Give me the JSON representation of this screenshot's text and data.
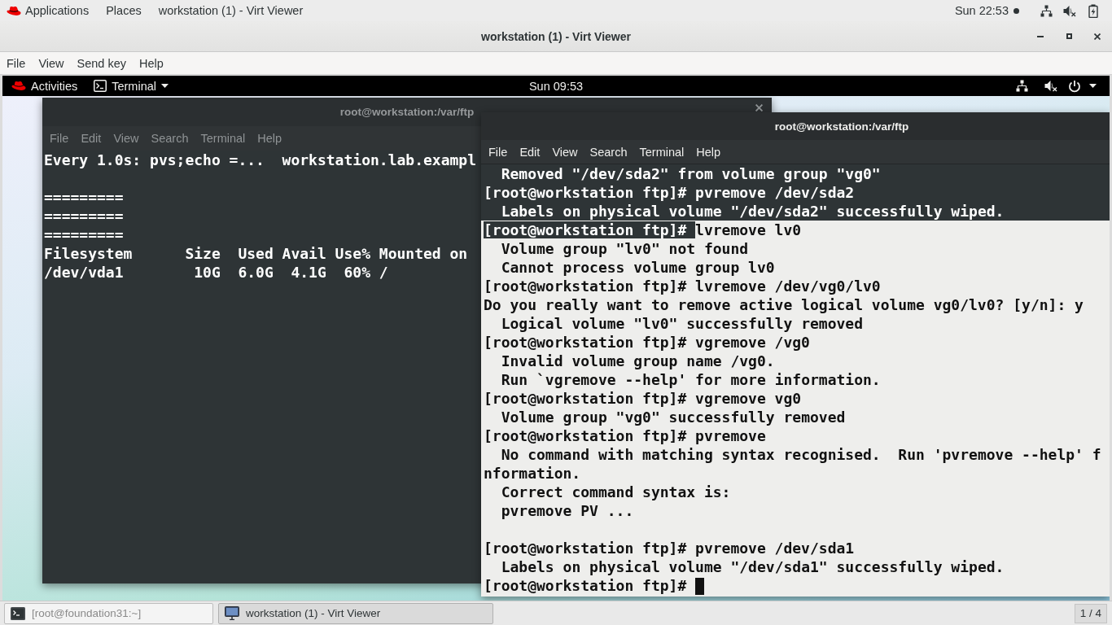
{
  "top_bar": {
    "menus": [
      "Applications",
      "Places"
    ],
    "window_title": "workstation (1) - Virt Viewer",
    "clock": "Sun 22:53"
  },
  "window": {
    "title": "workstation (1) - Virt Viewer",
    "menu": [
      "File",
      "View",
      "Send key",
      "Help"
    ]
  },
  "guest": {
    "top_bar": {
      "activities": "Activities",
      "app_menu": "Terminal",
      "clock": "Sun 09:53"
    },
    "terminals": [
      {
        "title": "root@workstation:/var/ftp",
        "focused": false,
        "dark_background": true,
        "cursor": false,
        "menu": [
          "File",
          "Edit",
          "View",
          "Search",
          "Terminal",
          "Help"
        ],
        "lines": [
          {
            "kind": "output",
            "text": "Every 1.0s: pvs;echo =...  workstation.lab.exampl"
          },
          {
            "kind": "blank"
          },
          {
            "kind": "output",
            "text": "========="
          },
          {
            "kind": "output",
            "text": "========="
          },
          {
            "kind": "output",
            "text": "========="
          },
          {
            "kind": "output",
            "text": "Filesystem      Size  Used Avail Use% Mounted on"
          },
          {
            "kind": "output",
            "text": "/dev/vda1        10G  6.0G  4.1G  60% /"
          }
        ]
      },
      {
        "title": "root@workstation:/var/ftp",
        "focused": true,
        "dark_background": false,
        "cursor": true,
        "menu": [
          "File",
          "Edit",
          "View",
          "Search",
          "Terminal",
          "Help"
        ],
        "lines": [
          {
            "kind": "output",
            "text": "  Removed \"/dev/sda2\" from volume group \"vg0\"",
            "highlighted": true
          },
          {
            "kind": "prompt",
            "prompt": "[root@workstation ftp]#",
            "text": "pvremove /dev/sda2",
            "highlighted": true,
            "prompt_highlighted": true
          },
          {
            "kind": "output",
            "text": "  Labels on physical volume \"/dev/sda2\" successfully wiped.",
            "highlighted": true
          },
          {
            "kind": "prompt",
            "prompt": "[root@workstation ftp]#",
            "text": "lvremove lv0",
            "highlighted": false,
            "prompt_highlighted": true
          },
          {
            "kind": "output",
            "text": "  Volume group \"lv0\" not found",
            "highlighted": false
          },
          {
            "kind": "output",
            "text": "  Cannot process volume group lv0",
            "highlighted": false
          },
          {
            "kind": "prompt",
            "prompt": "[root@workstation ftp]#",
            "text": "lvremove /dev/vg0/lv0",
            "highlighted": false,
            "prompt_highlighted": false
          },
          {
            "kind": "output",
            "text": "Do you really want to remove active logical volume vg0/lv0? [y/n]: y",
            "highlighted": false
          },
          {
            "kind": "output",
            "text": "  Logical volume \"lv0\" successfully removed",
            "highlighted": false
          },
          {
            "kind": "prompt",
            "prompt": "[root@workstation ftp]#",
            "text": "vgremove /vg0",
            "highlighted": false,
            "prompt_highlighted": false
          },
          {
            "kind": "output",
            "text": "  Invalid volume group name /vg0.",
            "highlighted": false
          },
          {
            "kind": "output",
            "text": "  Run `vgremove --help' for more information.",
            "highlighted": false
          },
          {
            "kind": "prompt",
            "prompt": "[root@workstation ftp]#",
            "text": "vgremove vg0",
            "highlighted": false,
            "prompt_highlighted": false
          },
          {
            "kind": "output",
            "text": "  Volume group \"vg0\" successfully removed",
            "highlighted": false
          },
          {
            "kind": "prompt",
            "prompt": "[root@workstation ftp]#",
            "text": "pvremove",
            "highlighted": false,
            "prompt_highlighted": false
          },
          {
            "kind": "output",
            "text": "  No command with matching syntax recognised.  Run 'pvremove --help' f",
            "highlighted": false
          },
          {
            "kind": "output",
            "text": "nformation.",
            "highlighted": false
          },
          {
            "kind": "output",
            "text": "  Correct command syntax is:",
            "highlighted": false
          },
          {
            "kind": "output",
            "text": "  pvremove PV ...",
            "highlighted": false
          },
          {
            "kind": "blank"
          },
          {
            "kind": "prompt",
            "prompt": "[root@workstation ftp]#",
            "text": "pvremove /dev/sda1",
            "highlighted": false,
            "prompt_highlighted": false
          },
          {
            "kind": "output",
            "text": "  Labels on physical volume \"/dev/sda1\" successfully wiped.",
            "highlighted": false
          },
          {
            "kind": "prompt",
            "prompt": "[root@workstation ftp]#",
            "highlighted": false,
            "prompt_highlighted": false
          }
        ]
      }
    ]
  },
  "taskbar": {
    "items": [
      {
        "label": "[root@foundation31:~]",
        "selected": false
      },
      {
        "label": "workstation (1) - Virt Viewer",
        "selected": true
      }
    ],
    "workspace": "1 / 4"
  }
}
